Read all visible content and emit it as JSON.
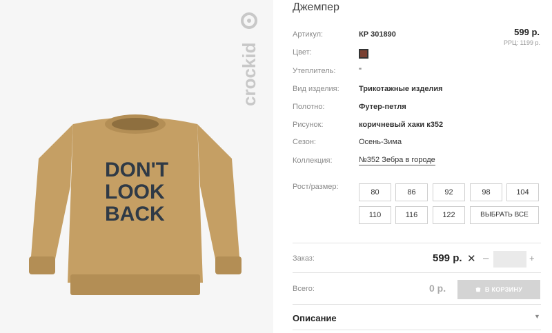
{
  "product": {
    "title": "Джемпер",
    "price": "599 р.",
    "rrc": "РРЦ: 1199 р.",
    "color_hex": "#7a4032",
    "print_lines": [
      "DON'T",
      "LOOK",
      "BACK"
    ],
    "brand": "crockid"
  },
  "specs": [
    {
      "label": "Артикул:",
      "value": "КР 301890",
      "style": "bold"
    },
    {
      "label": "Цвет:",
      "value": "",
      "style": "swatch"
    },
    {
      "label": "Утеплитель:",
      "value": "\"",
      "style": "plain"
    },
    {
      "label": "Вид изделия:",
      "value": "Трикотажные изделия",
      "style": "bold"
    },
    {
      "label": "Полотно:",
      "value": "Футер-петля",
      "style": "bold"
    },
    {
      "label": "Рисунок:",
      "value": "коричневый хаки к352",
      "style": "bold"
    },
    {
      "label": "Сезон:",
      "value": "Осень-Зима",
      "style": "plain"
    },
    {
      "label": "Коллекция:",
      "value": "№352 Зебра в городе",
      "style": "link"
    }
  ],
  "sizes": {
    "label": "Рост/размер:",
    "items": [
      "80",
      "86",
      "92",
      "98",
      "104",
      "110",
      "116",
      "122"
    ],
    "select_all": "ВЫБРАТЬ ВСЕ"
  },
  "order": {
    "label": "Заказ:",
    "price": "599 р.",
    "times": "✕",
    "minus": "–",
    "plus": "+",
    "qty": ""
  },
  "total": {
    "label": "Всего:",
    "value": "0 р.",
    "cart_button": "В КОРЗИНУ"
  },
  "description": {
    "label": "Описание",
    "chevron": "▼"
  },
  "colors": {
    "sweater": "#c59f64",
    "sweater_shade": "#b38e55",
    "swatch": "#7a4032",
    "button_disabled": "#d4d4d4"
  }
}
